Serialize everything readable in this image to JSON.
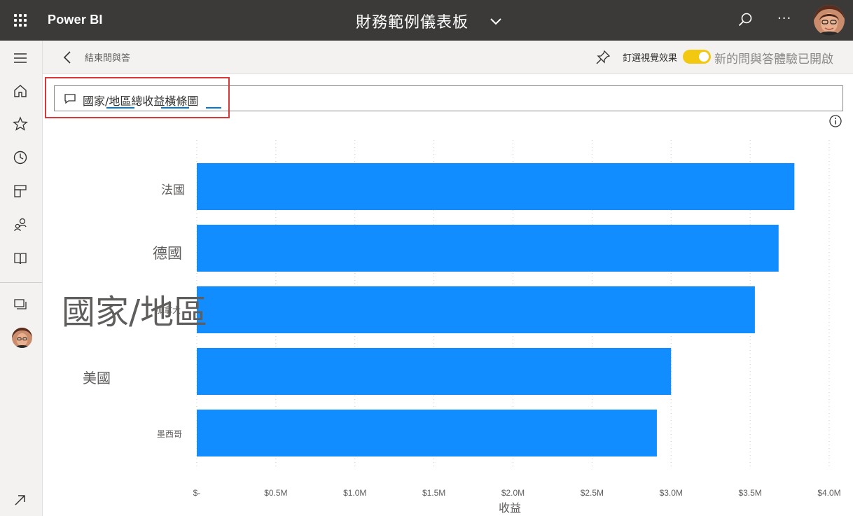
{
  "topbar": {
    "brand": "Power BI",
    "dashboard_title": "財務範例儀表板",
    "more_label": "···"
  },
  "leftnav": {
    "items": [
      {
        "name": "menu",
        "icon": "hamburger-icon"
      },
      {
        "name": "home",
        "icon": "home-icon"
      },
      {
        "name": "favorites",
        "icon": "star-icon"
      },
      {
        "name": "recent",
        "icon": "clock-icon"
      },
      {
        "name": "apps",
        "icon": "apps-icon"
      },
      {
        "name": "shared",
        "icon": "shared-icon"
      },
      {
        "name": "learn",
        "icon": "book-icon"
      },
      {
        "name": "workspaces",
        "icon": "workspaces-icon"
      }
    ]
  },
  "subheader": {
    "exit_label": "結束問與答",
    "pin_label": "釘選視覺效果",
    "toggle_label": "新的問與答體驗已開啟",
    "toggle_on": true
  },
  "qa": {
    "query": "國家/地區總收益橫條圖"
  },
  "colors": {
    "bar": "#118dff",
    "topbar": "#3b3a39",
    "toggle": "#f2c811",
    "highlight": "#d9383a"
  },
  "chart_data": {
    "type": "bar",
    "orientation": "horizontal",
    "categories": [
      "法國",
      "德國",
      "加拿大",
      "美國",
      "墨西哥"
    ],
    "values": [
      3.78,
      3.68,
      3.53,
      3.0,
      2.91
    ],
    "unit": "M",
    "xlabel": "收益",
    "ylabel": "國家/地區",
    "xlim": [
      0,
      4.0
    ],
    "x_ticks": [
      "$-",
      "$0.5M",
      "$1.0M",
      "$1.5M",
      "$2.0M",
      "$2.5M",
      "$3.0M",
      "$3.5M",
      "$4.0M"
    ],
    "grid": "vertical-dotted",
    "legend": "none"
  }
}
